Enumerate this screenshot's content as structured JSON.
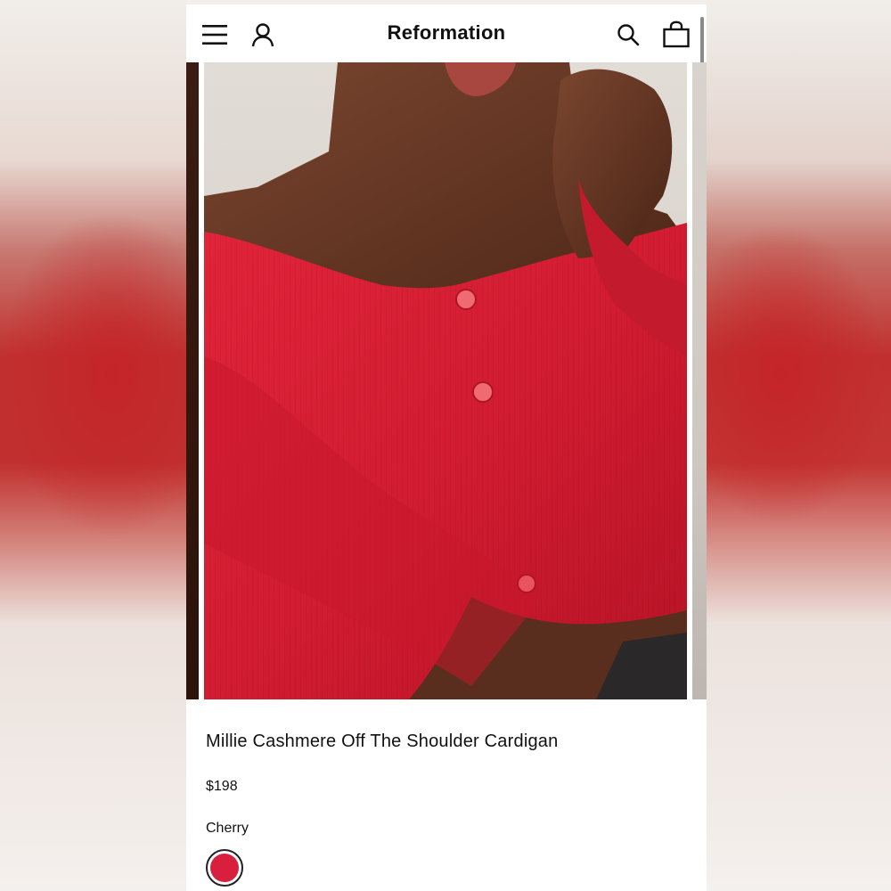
{
  "header": {
    "brand": "Reformation",
    "menu_icon": "hamburger-menu-icon",
    "account_icon": "user-icon",
    "search_icon": "search-icon",
    "bag_icon": "shopping-bag-icon"
  },
  "product": {
    "name": "Millie Cashmere Off The Shoulder Cardigan",
    "price": "$198",
    "color_name": "Cherry",
    "swatch_color": "#d81f3d"
  },
  "colors": {
    "sweater": "#d41e2e",
    "skin": "#6b3b26",
    "background": "#d9d3ce"
  }
}
